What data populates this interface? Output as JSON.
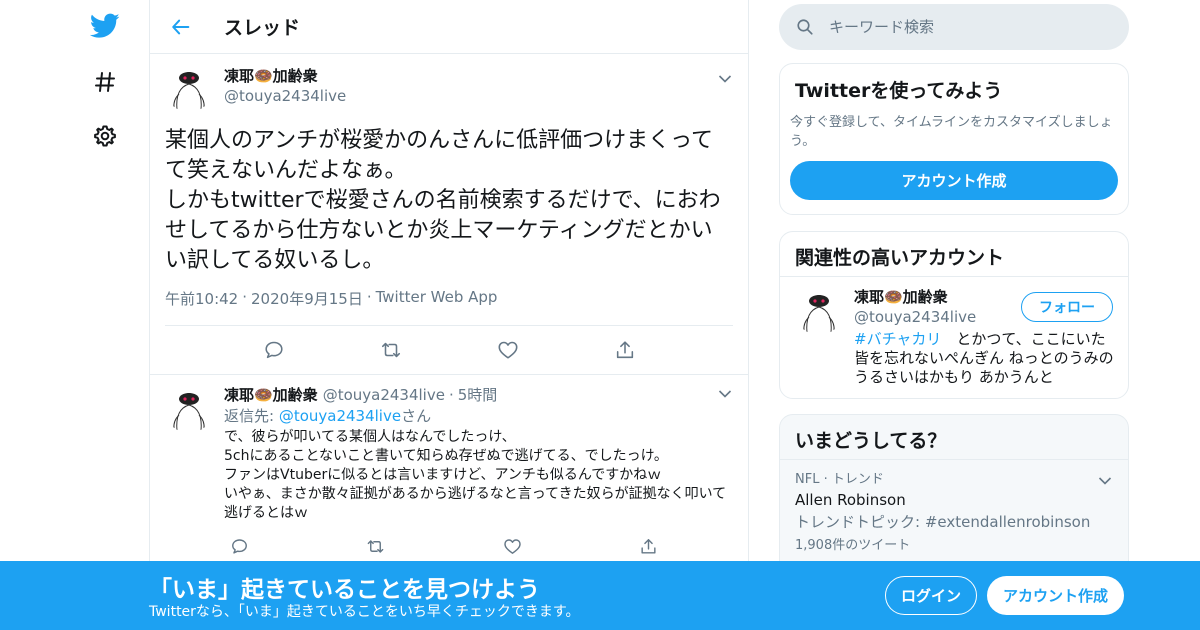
{
  "colors": {
    "accent": "#1da1f2",
    "text": "#14171a",
    "muted": "#657786",
    "border": "#e6ecf0"
  },
  "nav": {
    "icons": [
      "twitter-logo-icon",
      "hashtag-icon",
      "gear-icon"
    ]
  },
  "header": {
    "title": "スレッド"
  },
  "main_tweet": {
    "display_name": "凍耶🍩加齢衆",
    "handle": "@touya2434live",
    "text": "某個人のアンチが桜愛かのんさんに低評価つけまくってて笑えないんだよなぁ。\nしかもtwitterで桜愛さんの名前検索するだけで、におわせしてるから仕方ないとか炎上マーケティングだとかいい訳してる奴いるし。",
    "time": "午前10:42",
    "date": "2020年9月15日",
    "source": "Twitter Web App",
    "separator": "·"
  },
  "reply_tweet": {
    "display_name": "凍耶🍩加齢衆",
    "handle": "@touya2434live",
    "separator": "·",
    "time": "5時間",
    "reply_prefix": "返信先: ",
    "reply_to": "@touya2434live",
    "reply_suffix": "さん",
    "text": "で、彼らが叩いてる某個人はなんでしたっけ、\n5chにあることないこと書いて知らぬ存ぜぬで逃げてる、でしたっけ。\nファンはVtuberに似るとは言いますけど、アンチも似るんですかねｗ\nいやぁ、まさか散々証拠があるから逃げるなと言ってきた奴らが証拠なく叩いて逃げるとはｗ"
  },
  "search": {
    "placeholder": "キーワード検索"
  },
  "signup_card": {
    "title": "Twitterを使ってみよう",
    "description": "今すぐ登録して、タイムラインをカスタマイズしましょう。",
    "button": "アカウント作成"
  },
  "related_card": {
    "title": "関連性の高いアカウント",
    "account": {
      "display_name": "凍耶🍩加齢衆",
      "handle": "@touya2434live",
      "follow_label": "フォロー",
      "bio_hashtag": "#バチャカリ",
      "bio_text": "　とかつて、ここにいた皆を忘れないぺんぎん ねっとのうみのうるさいはかもり あかうんと"
    }
  },
  "trends_card": {
    "title": "いまどうしてる？",
    "trend": {
      "category": "NFL · トレンド",
      "name": "Allen Robinson",
      "topic": "トレンドトピック: #extendallenrobinson",
      "count": "1,908件のツイート"
    }
  },
  "banner": {
    "title": "「いま」起きていることを見つけよう",
    "subtitle": "Twitterなら、「いま」起きていることをいち早くチェックできます。",
    "login": "ログイン",
    "signup": "アカウント作成"
  }
}
